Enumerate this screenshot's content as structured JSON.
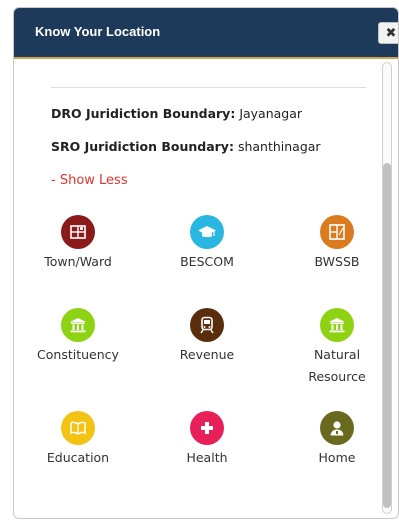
{
  "header": {
    "title": "Know Your Location",
    "close_glyph": "✖"
  },
  "info": {
    "dro_label": "DRO Juridiction Boundary:",
    "dro_value": "Jayanagar",
    "sro_label": "SRO Juridiction Boundary:",
    "sro_value": "shanthinagar",
    "toggle": "- Show Less"
  },
  "tiles": [
    {
      "label": "Town/Ward",
      "icon": "map-grid-icon",
      "color": "#8b1a1a"
    },
    {
      "label": "BESCOM",
      "icon": "graduation-cap-icon",
      "color": "#29b6e1"
    },
    {
      "label": "BWSSB",
      "icon": "floorplan-icon",
      "color": "#d97b1e"
    },
    {
      "label": "Constituency",
      "icon": "government-building-icon",
      "color": "#8ed313"
    },
    {
      "label": "Revenue",
      "icon": "train-icon",
      "color": "#5a2d0c"
    },
    {
      "label": "Natural",
      "label2": "Resource",
      "icon": "government-building-icon",
      "color": "#8ed313"
    },
    {
      "label": "Education",
      "icon": "book-icon",
      "color": "#f2c313"
    },
    {
      "label": "Health",
      "icon": "medical-cross-icon",
      "color": "#e8205a"
    },
    {
      "label": "Home",
      "icon": "person-badge-icon",
      "color": "#6a6a1e"
    }
  ]
}
